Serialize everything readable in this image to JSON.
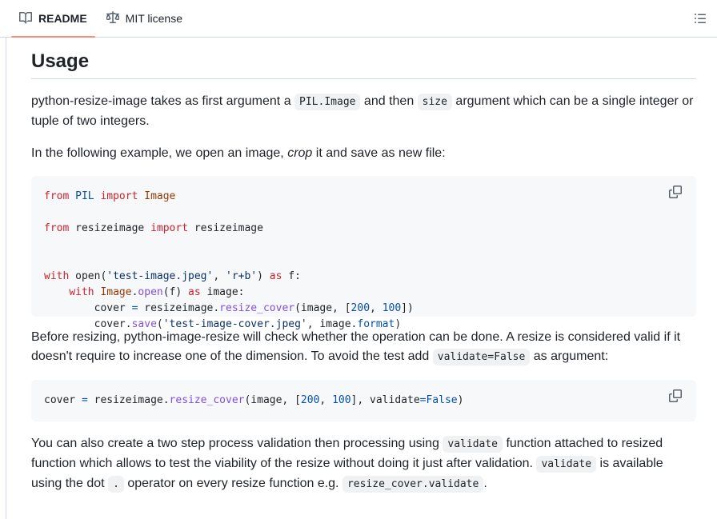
{
  "tabs": {
    "readme_label": "README",
    "license_label": "MIT license"
  },
  "section": {
    "title": "Usage"
  },
  "para1": {
    "t1": "python-resize-image takes as first argument a ",
    "code1": "PIL.Image",
    "t2": " and then ",
    "code2": "size",
    "t3": " argument which can be a single integer or tuple of two integers."
  },
  "para2": {
    "t1": "In the following example, we open an image, ",
    "em": "crop",
    "t2": " it and save as new file:"
  },
  "code_block_1": {
    "l1_kw1": "from",
    "l1_mod": " PIL ",
    "l1_kw2": "import",
    "l1_name": " Image",
    "l2_kw1": "from",
    "l2_mod": " resizeimage ",
    "l2_kw2": "import",
    "l2_name": " resizeimage",
    "l3_kw": "with",
    "l3_fn": " open",
    "l3_p1": "(",
    "l3_s1": "'test-image.jpeg'",
    "l3_c": ", ",
    "l3_s2": "'r+b'",
    "l3_p2": ") ",
    "l3_kw2": "as",
    "l3_v": " f:",
    "l4_ind": "    ",
    "l4_kw": "with",
    "l4_cls": " Image",
    "l4_dot": ".",
    "l4_fn": "open",
    "l4_a": "(f) ",
    "l4_kw2": "as",
    "l4_v": " image:",
    "l5_ind": "        ",
    "l5_v": "cover",
    "l5_eq": " = ",
    "l5_mod": "resizeimage.",
    "l5_fn": "resize_cover",
    "l5_a": "(image, [",
    "l5_n1": "200",
    "l5_c": ", ",
    "l5_n2": "100",
    "l5_e": "])",
    "l6_ind": "        ",
    "l6_v": "cover.",
    "l6_fn": "save",
    "l6_p": "(",
    "l6_s": "'test-image-cover.jpeg'",
    "l6_a": ", image.",
    "l6_attr": "format",
    "l6_e": ")"
  },
  "para3": {
    "t1": "Before resizing, python-image-resize will check whether the operation can be done. A resize is considered valid if it doesn't require to increase one of the dimension. To avoid the test add ",
    "code1": "validate=False",
    "t2": " as argument:"
  },
  "code_block_2": {
    "v": "cover",
    "eq": " = ",
    "mod": "resizeimage.",
    "fn": "resize_cover",
    "a": "(image, [",
    "n1": "200",
    "c": ", ",
    "n2": "100",
    "a2": "], validate",
    "eq2": "=",
    "bool": "False",
    "e": ")"
  },
  "para4": {
    "t1": "You can also create a two step process validation then processing using ",
    "code1": "validate",
    "t2": " function attached to resized function which allows to test the viability of the resize without doing it just after validation. ",
    "code2": "validate",
    "t3": " is available using the dot ",
    "code3": ".",
    "t4": " operator on every resize function e.g. ",
    "code4": "resize_cover.validate",
    "t5": "."
  },
  "icons": {
    "readme": "book-icon",
    "license": "law-scale-icon",
    "toc": "list-unordered-icon",
    "copy": "copy-icon"
  },
  "colors": {
    "active_tab_underline": "#fd8c73",
    "keyword": "#cf222e",
    "function": "#8250df",
    "string": "#0a3069",
    "number": "#0550ae"
  }
}
